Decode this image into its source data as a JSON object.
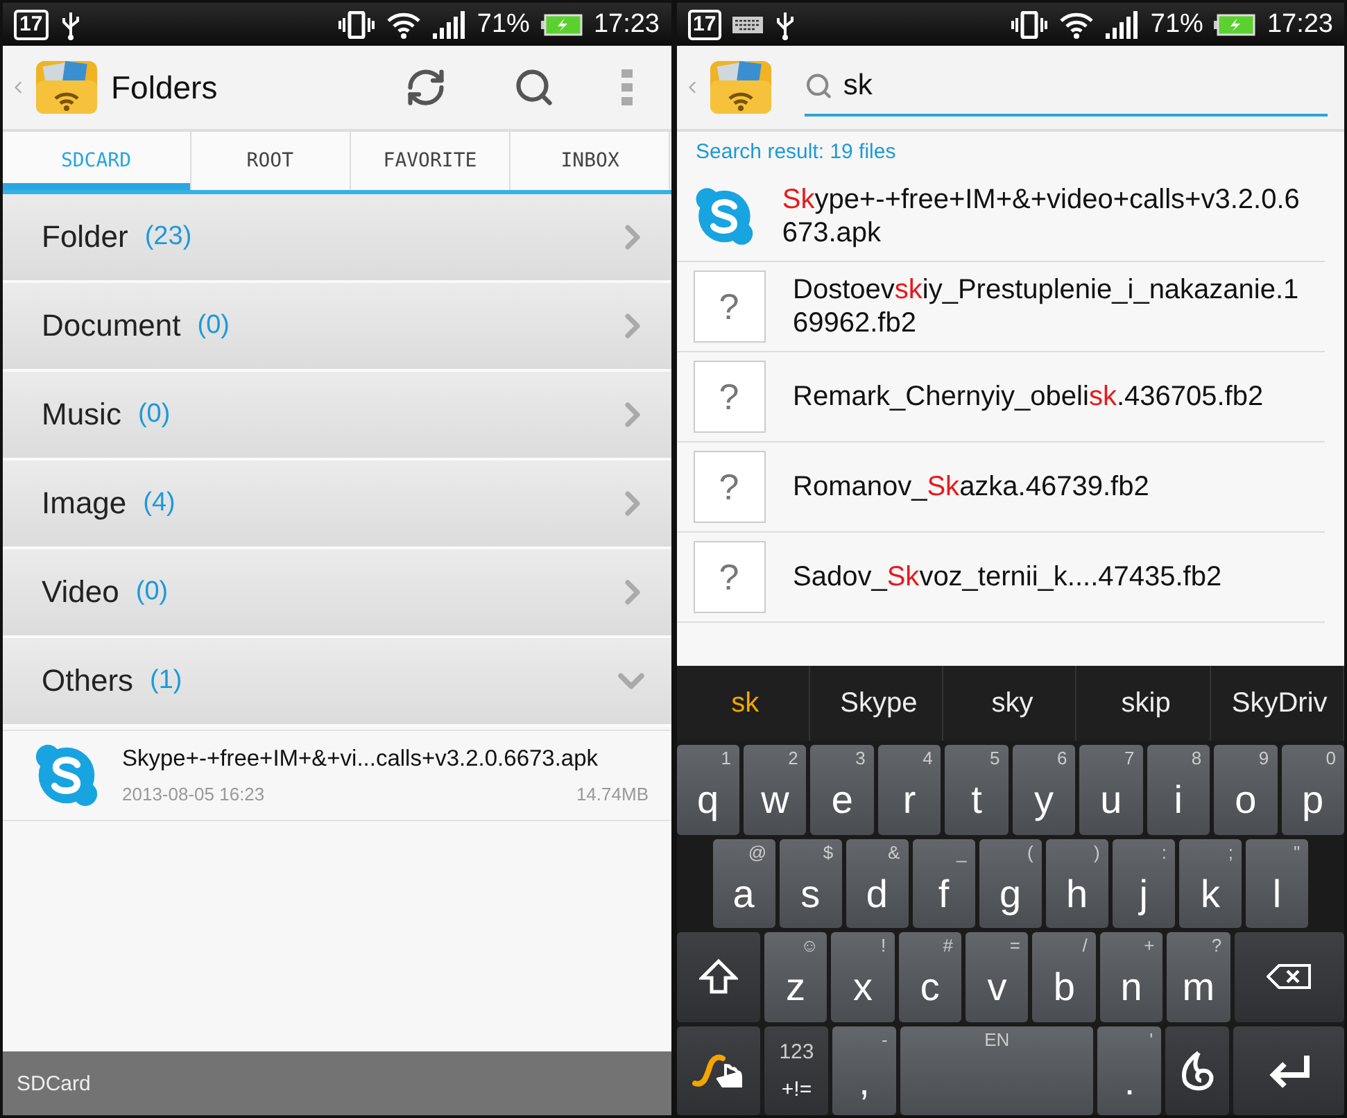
{
  "left": {
    "status_bar": {
      "battery": "71%",
      "time": "17:23",
      "indicators": [
        {
          "kind": "calendar",
          "text": "17"
        },
        {
          "kind": "usb"
        }
      ]
    },
    "action_bar": {
      "title": "Folders"
    },
    "tabs": [
      {
        "label": "SDCARD",
        "selected": true
      },
      {
        "label": "ROOT",
        "selected": false
      },
      {
        "label": "FAVORITE",
        "selected": false
      },
      {
        "label": "INBOX",
        "selected": false
      }
    ],
    "categories": [
      {
        "name": "Folder",
        "count": "(23)",
        "expanded": false
      },
      {
        "name": "Document",
        "count": "(0)",
        "expanded": false
      },
      {
        "name": "Music",
        "count": "(0)",
        "expanded": false
      },
      {
        "name": "Image",
        "count": "(4)",
        "expanded": false
      },
      {
        "name": "Video",
        "count": "(0)",
        "expanded": false
      },
      {
        "name": "Others",
        "count": "(1)",
        "expanded": true
      }
    ],
    "files": [
      {
        "name": "Skype+-+free+IM+&+vi...calls+v3.2.0.6673.apk",
        "date": "2013-08-05 16:23",
        "size": "14.74MB"
      }
    ],
    "bottom_bar": "SDCard"
  },
  "right": {
    "status_bar": {
      "battery": "71%",
      "time": "17:23",
      "indicators": [
        {
          "kind": "calendar",
          "text": "17"
        },
        {
          "kind": "keyboard"
        },
        {
          "kind": "usb"
        }
      ]
    },
    "search": {
      "value": "sk"
    },
    "result_summary": "Search result: 19 files",
    "results": [
      {
        "kind": "app",
        "match": "Sk",
        "after": "ype+-+free+IM+&+video+calls+v3.2.0.6673.apk"
      },
      {
        "kind": "unknown",
        "glyph": "?",
        "before": "Dostoev",
        "match": "sk",
        "after": "iy_Prestuplenie_i_nakazanie.169962.fb2"
      },
      {
        "kind": "unknown",
        "glyph": "?",
        "before": "Remark_Chernyiy_obeli",
        "match": "sk",
        "after": ".436705.fb2"
      },
      {
        "kind": "unknown",
        "glyph": "?",
        "before": "Romanov_",
        "match": "Sk",
        "after": "azka.46739.fb2"
      },
      {
        "kind": "unknown",
        "glyph": "?",
        "before": "Sadov_",
        "match": "Sk",
        "after": "voz_ternii_k....47435.fb2"
      }
    ],
    "suggestions": [
      {
        "text": "sk",
        "selected": true
      },
      {
        "text": "Skype",
        "selected": false
      },
      {
        "text": "sky",
        "selected": false
      },
      {
        "text": "skip",
        "selected": false
      },
      {
        "text": "SkyDriv",
        "selected": false
      }
    ],
    "keyboard": [
      [
        {
          "kind": "char",
          "label": "q",
          "hint": "1"
        },
        {
          "kind": "char",
          "label": "w",
          "hint": "2"
        },
        {
          "kind": "char",
          "label": "e",
          "hint": "3"
        },
        {
          "kind": "char",
          "label": "r",
          "hint": "4"
        },
        {
          "kind": "char",
          "label": "t",
          "hint": "5"
        },
        {
          "kind": "char",
          "label": "y",
          "hint": "6"
        },
        {
          "kind": "char",
          "label": "u",
          "hint": "7"
        },
        {
          "kind": "char",
          "label": "i",
          "hint": "8"
        },
        {
          "kind": "char",
          "label": "o",
          "hint": "9"
        },
        {
          "kind": "char",
          "label": "p",
          "hint": "0"
        }
      ],
      [
        {
          "kind": "char",
          "label": "a",
          "hint": "@"
        },
        {
          "kind": "char",
          "label": "s",
          "hint": "$"
        },
        {
          "kind": "char",
          "label": "d",
          "hint": "&"
        },
        {
          "kind": "char",
          "label": "f",
          "hint": "_"
        },
        {
          "kind": "char",
          "label": "g",
          "hint": "("
        },
        {
          "kind": "char",
          "label": "h",
          "hint": ")"
        },
        {
          "kind": "char",
          "label": "j",
          "hint": ":"
        },
        {
          "kind": "char",
          "label": "k",
          "hint": ";"
        },
        {
          "kind": "char",
          "label": "l",
          "hint": "\""
        }
      ],
      [
        {
          "kind": "shift"
        },
        {
          "kind": "char",
          "label": "z",
          "hint": "☺"
        },
        {
          "kind": "char",
          "label": "x",
          "hint": "!"
        },
        {
          "kind": "char",
          "label": "c",
          "hint": "#"
        },
        {
          "kind": "char",
          "label": "v",
          "hint": "="
        },
        {
          "kind": "char",
          "label": "b",
          "hint": "/"
        },
        {
          "kind": "char",
          "label": "n",
          "hint": "+"
        },
        {
          "kind": "char",
          "label": "m",
          "hint": "?"
        },
        {
          "kind": "backspace"
        }
      ],
      [
        {
          "kind": "swype"
        },
        {
          "kind": "symbols",
          "label": "+!=",
          "hint": "123"
        },
        {
          "kind": "char",
          "label": ",",
          "hint": "-"
        },
        {
          "kind": "space",
          "hint": "EN"
        },
        {
          "kind": "char",
          "label": ".",
          "hint": "'"
        },
        {
          "kind": "dragon"
        },
        {
          "kind": "enter"
        }
      ]
    ]
  }
}
